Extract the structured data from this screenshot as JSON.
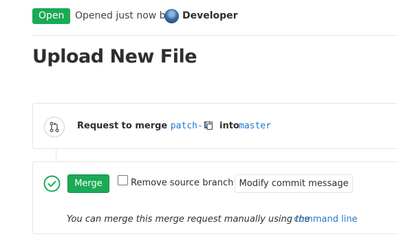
{
  "header": {
    "status_badge": "Open",
    "opened_text": "Opened just now by",
    "author": "Developer",
    "avatar_icon": "developer-avatar"
  },
  "title": "Upload New File",
  "merge_info": {
    "request_label": "Request to merge",
    "source_branch": "patch-17",
    "copy_icon": "copy-icon",
    "into_label": "into",
    "target_branch": "master",
    "merge_request_icon": "merge-request-icon"
  },
  "merge_widget": {
    "status_icon": "check-circle-icon",
    "merge_button": "Merge",
    "remove_source_label": "Remove source branch",
    "remove_source_checked": false,
    "modify_commit_button": "Modify commit message",
    "manual_text": "You can merge this merge request manually using the",
    "command_line_link": "command line"
  },
  "colors": {
    "success": "#1aaa55",
    "link": "#1f78d1",
    "border": "#e5e5e5",
    "text": "#2e2e2e"
  }
}
